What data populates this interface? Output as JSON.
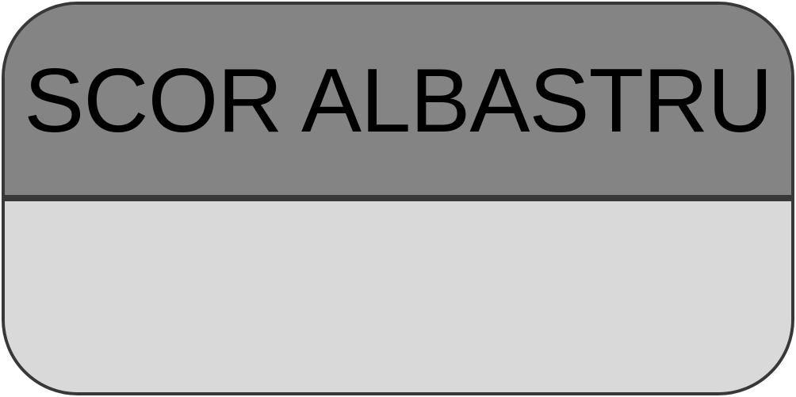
{
  "card": {
    "title": "SCOR ALBASTRU",
    "value": ""
  },
  "colors": {
    "header_background": "#848484",
    "body_background": "#d9d9d9",
    "border": "#383838",
    "text": "#000000"
  }
}
